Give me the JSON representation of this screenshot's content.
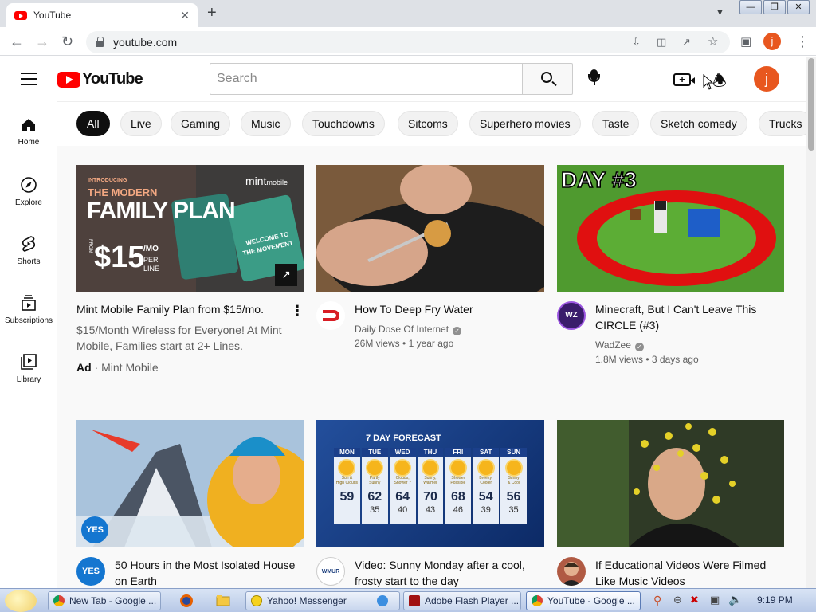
{
  "browser": {
    "tab_title": "YouTube",
    "tab_close": "✕",
    "new_tab": "+",
    "url": "youtube.com",
    "profile_initial": "j"
  },
  "youtube": {
    "logo_text": "YouTube",
    "search_placeholder": "Search",
    "avatar_initial": "j",
    "create_icon_plus": "+"
  },
  "sidebar": {
    "items": [
      {
        "label": "Home",
        "icon": "home-icon"
      },
      {
        "label": "Explore",
        "icon": "compass-icon"
      },
      {
        "label": "Shorts",
        "icon": "shorts-icon"
      },
      {
        "label": "Subscriptions",
        "icon": "subscriptions-icon"
      },
      {
        "label": "Library",
        "icon": "library-icon"
      }
    ]
  },
  "chips": [
    "All",
    "Live",
    "Gaming",
    "Music",
    "Touchdowns",
    "Sitcoms",
    "Superhero movies",
    "Taste",
    "Sketch comedy",
    "Trucks"
  ],
  "videos": [
    {
      "title": "Mint Mobile Family Plan from $15/mo.",
      "description": "$15/Month Wireless for Everyone! At Mint Mobile, Families start at 2+ Lines.",
      "ad_label": "Ad",
      "advertiser": "Mint Mobile",
      "thumb": {
        "banner": "INTRODUCING",
        "headline_1": "THE MODERN",
        "headline_2": "FAMILY PLAN",
        "brand": "mint",
        "brand_suffix": "mobile",
        "price": "$15",
        "price_suffix_1": "/MO",
        "price_suffix_2": "PER",
        "price_suffix_3": "LINE",
        "price_prefix": "FROM",
        "card_text_1": "WELCOME TO",
        "card_text_2": "THE MOVEMENT"
      }
    },
    {
      "title": "How To Deep Fry Water",
      "channel": "Daily Dose Of Internet",
      "views": "26M views",
      "age": "1 year ago"
    },
    {
      "title": "Minecraft, But I Can't Leave This CIRCLE (#3)",
      "channel": "WadZee",
      "views": "1.8M views",
      "age": "3 days ago",
      "thumb_text": "DAY #3",
      "avatar_text": "WZ"
    },
    {
      "title": "50 Hours in the Most Isolated House on Earth",
      "thumb_badge": "YES",
      "avatar_text": "YES"
    },
    {
      "title": "Video: Sunny Monday after a cool, frosty start to the day",
      "avatar_text": "WMUR",
      "forecast": {
        "heading": "7 DAY FORECAST",
        "days": [
          {
            "day": "MON",
            "cond_1": "Sun &",
            "cond_2": "High Clouds",
            "high": "59",
            "low": ""
          },
          {
            "day": "TUE",
            "cond_1": "Partly",
            "cond_2": "Sunny",
            "high": "62",
            "low": "35"
          },
          {
            "day": "WED",
            "cond_1": "Clouds,",
            "cond_2": "Shower ?",
            "high": "64",
            "low": "40"
          },
          {
            "day": "THU",
            "cond_1": "Sunny,",
            "cond_2": "Warmer",
            "high": "70",
            "low": "43"
          },
          {
            "day": "FRI",
            "cond_1": "Shower",
            "cond_2": "Possible",
            "high": "68",
            "low": "46"
          },
          {
            "day": "SAT",
            "cond_1": "Breezy,",
            "cond_2": "Cooler",
            "high": "54",
            "low": "39"
          },
          {
            "day": "SUN",
            "cond_1": "Sunny",
            "cond_2": "& Cool",
            "high": "56",
            "low": "35"
          }
        ]
      }
    },
    {
      "title": "If Educational Videos Were Filmed Like Music Videos"
    }
  ],
  "taskbar": {
    "tasks": [
      {
        "label": "New Tab - Google ..."
      },
      {
        "label": "Yahoo! Messenger"
      },
      {
        "label": "Adobe Flash Player ..."
      },
      {
        "label": "YouTube - Google ..."
      }
    ],
    "clock": "9:19 PM"
  },
  "colors": {
    "youtube_red": "#ff0000",
    "avatar_orange": "#e8571f",
    "chip_active": "#0f0f0f",
    "taskbar": "#c6d6ee"
  }
}
